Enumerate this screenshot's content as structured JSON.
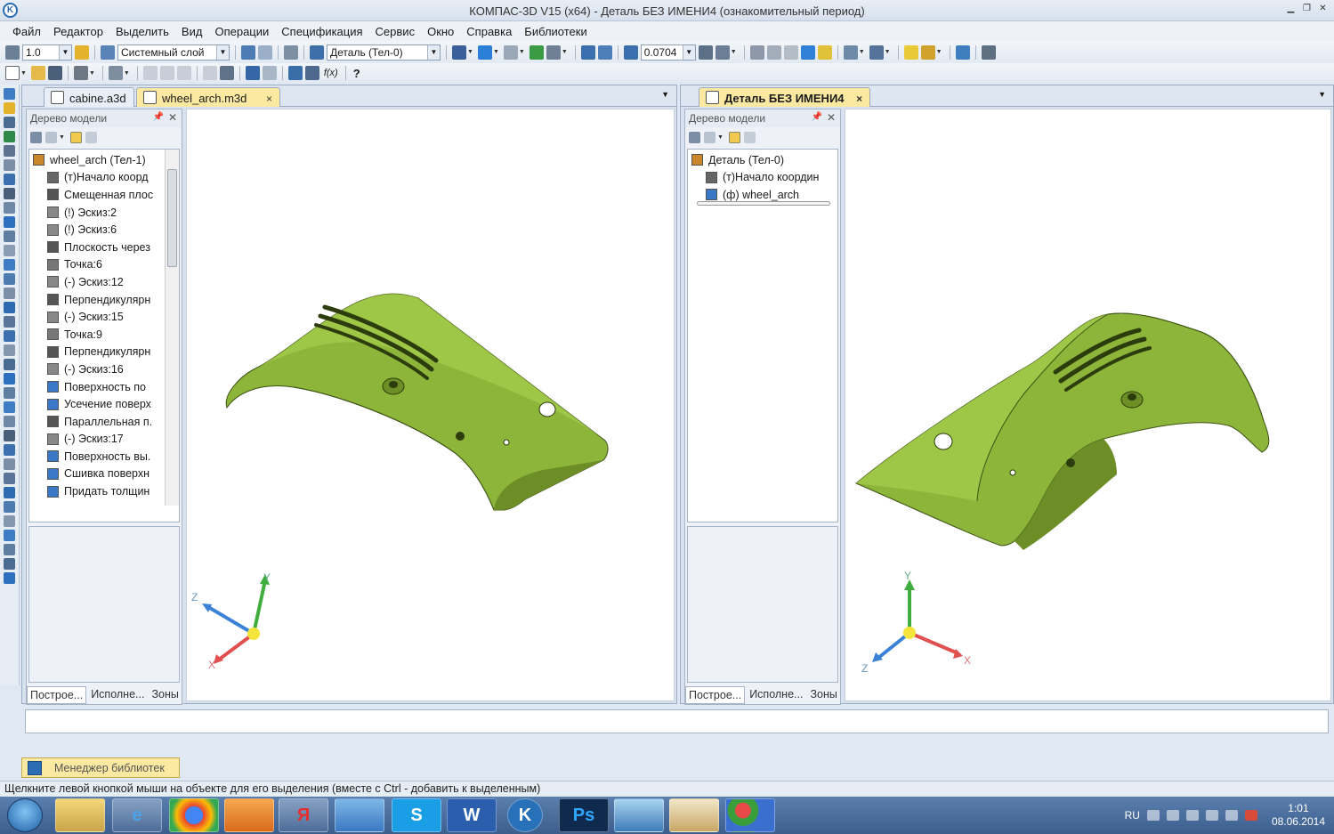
{
  "window": {
    "title": "КОМПАС-3D V15 (x64) - Деталь БЕЗ ИМЕНИ4 (ознакомительный период)",
    "minimize": "▁",
    "restore": "❐",
    "close": "✕"
  },
  "menu": [
    "Файл",
    "Редактор",
    "Выделить",
    "Вид",
    "Операции",
    "Спецификация",
    "Сервис",
    "Окно",
    "Справка",
    "Библиотеки"
  ],
  "toolbar1": {
    "scale": "1.0",
    "layer": "Системный слой",
    "part": "Деталь (Тел-0)",
    "zoom": "0.0704"
  },
  "toolbar2": {
    "fx": "f(x)",
    "help": "?"
  },
  "left_doc": {
    "tabs": [
      {
        "label": "cabine.a3d",
        "active": false
      },
      {
        "label": "wheel_arch.m3d",
        "active": true
      }
    ],
    "close": "×",
    "tree_title": "Дерево модели",
    "tree_items": [
      {
        "label": "wheel_arch (Тел-1)",
        "color": "#c9862a"
      },
      {
        "label": "(т)Начало коорд",
        "color": "#666666"
      },
      {
        "label": "Смещенная плос",
        "color": "#555555"
      },
      {
        "label": "(!) Эскиз:2",
        "color": "#888888"
      },
      {
        "label": "(!) Эскиз:6",
        "color": "#888888"
      },
      {
        "label": "Плоскость через",
        "color": "#555555"
      },
      {
        "label": "Точка:6",
        "color": "#777777"
      },
      {
        "label": "(-) Эскиз:12",
        "color": "#888888"
      },
      {
        "label": "Перпендикулярн",
        "color": "#555555"
      },
      {
        "label": "(-) Эскиз:15",
        "color": "#888888"
      },
      {
        "label": "Точка:9",
        "color": "#777777"
      },
      {
        "label": "Перпендикулярн",
        "color": "#555555"
      },
      {
        "label": "(-) Эскиз:16",
        "color": "#888888"
      },
      {
        "label": "Поверхность по",
        "color": "#3c78c8"
      },
      {
        "label": "Усечение поверх",
        "color": "#3c78c8"
      },
      {
        "label": "Параллельная п.",
        "color": "#555555"
      },
      {
        "label": "(-) Эскиз:17",
        "color": "#888888"
      },
      {
        "label": "Поверхность вы.",
        "color": "#3c78c8"
      },
      {
        "label": "Сшивка поверхн",
        "color": "#3c78c8"
      },
      {
        "label": "Придать толщин",
        "color": "#3c78c8"
      }
    ],
    "bottom_tabs": [
      "Построе...",
      "Исполне...",
      "Зоны"
    ],
    "axes": {
      "x": "X",
      "y": "Y",
      "z": "Z"
    }
  },
  "right_doc": {
    "tabs": [
      {
        "label": "Деталь БЕЗ ИМЕНИ4",
        "active": true
      }
    ],
    "close": "×",
    "tree_title": "Дерево модели",
    "tree_items": [
      {
        "label": "Деталь (Тел-0)",
        "color": "#c9862a"
      },
      {
        "label": "(т)Начало координ",
        "color": "#666666"
      },
      {
        "label": "(ф) wheel_arch",
        "color": "#3c78c8"
      }
    ],
    "bottom_tabs": [
      "Построе...",
      "Исполне...",
      "Зоны"
    ],
    "axes": {
      "x": "X",
      "y": "Y",
      "z": "Z"
    }
  },
  "model_color": "#8cb53a",
  "library_manager": "Менеджер библиотек",
  "status_text": "Щелкните левой кнопкой мыши на объекте для его выделения (вместе с Ctrl - добавить к выделенным)",
  "taskbar": {
    "apps": [
      "Explorer",
      "Internet Explorer",
      "Chrome",
      "Media Player",
      "Yandex",
      "Mail",
      "Skype",
      "Word",
      "Kompas",
      "Photoshop",
      "Photos",
      "Paint",
      "Other"
    ],
    "app_glyphs": {
      "yandex": "Я",
      "photoshop": "Ps",
      "word": "W",
      "skype": "S",
      "kompas": "K",
      "ie": "e"
    },
    "lang": "RU",
    "time": "1:01",
    "date": "08.06.2014"
  }
}
